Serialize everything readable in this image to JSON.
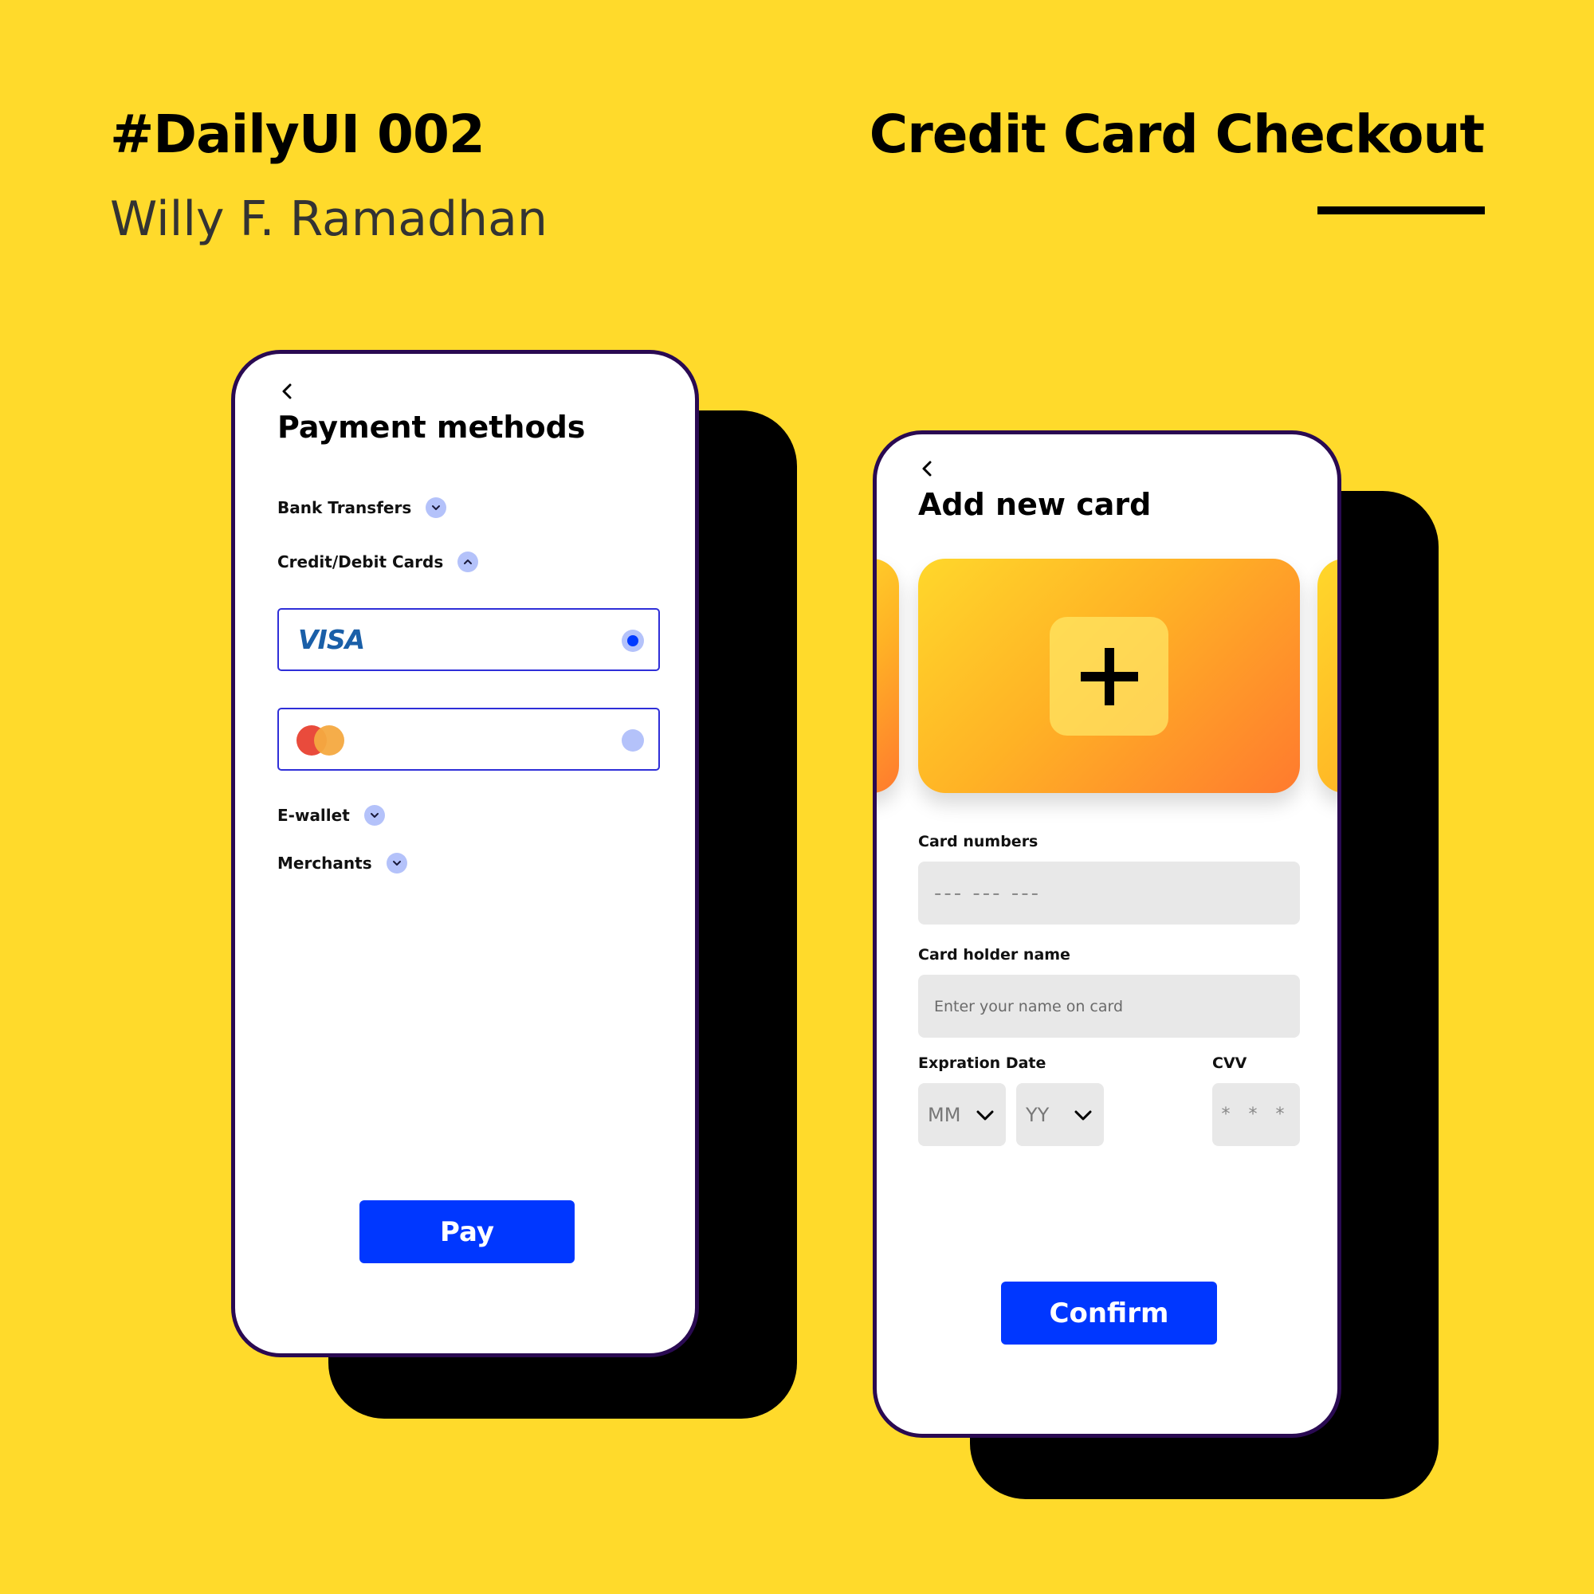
{
  "header": {
    "title": "#DailyUI 002",
    "author": "Willy F. Ramadhan",
    "subject": "Credit Card Checkout"
  },
  "payment_screen": {
    "title": "Payment methods",
    "sections": [
      {
        "label": "Bank Transfers",
        "state": "collapsed"
      },
      {
        "label": "Credit/Debit Cards",
        "state": "expanded"
      },
      {
        "label": "E-wallet",
        "state": "collapsed"
      },
      {
        "label": "Merchants",
        "state": "collapsed"
      }
    ],
    "cards": [
      {
        "brand": "VISA",
        "selected": true
      },
      {
        "brand": "mastercard-logo",
        "selected": false
      }
    ],
    "pay_label": "Pay"
  },
  "add_card_screen": {
    "title": "Add new card",
    "card_numbers_label": "Card numbers",
    "card_numbers_placeholder": "--- --- ---",
    "holder_label": "Card holder name",
    "holder_placeholder": "Enter your name on card",
    "expiration_label": "Expration Date",
    "month_value": "MM",
    "year_value": "YY",
    "cvv_label": "CVV",
    "cvv_placeholder": "* * *",
    "confirm_label": "Confirm"
  },
  "colors": {
    "background": "#FFDA2B",
    "primary": "#0037FF",
    "accent_light": "#B4C2FA",
    "phone_border": "#2A0A52"
  }
}
